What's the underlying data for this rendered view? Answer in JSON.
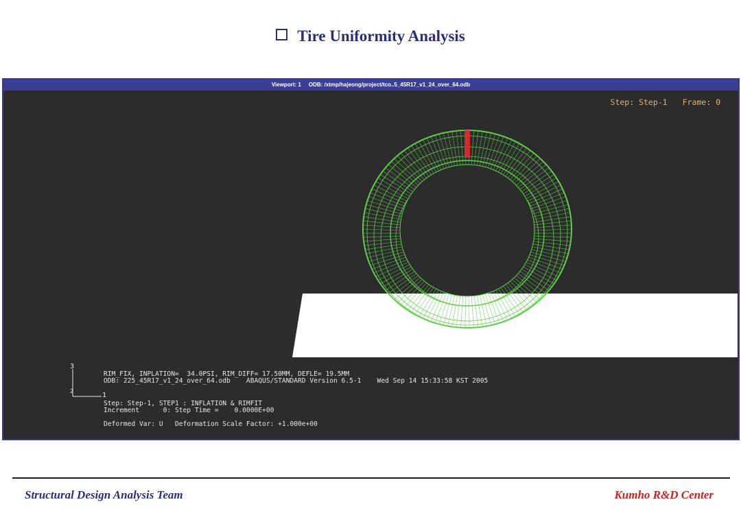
{
  "slide": {
    "title": "Tire Uniformity Analysis"
  },
  "viewport": {
    "titlebar": "Viewport: 1     ODB: /xtmp/hajeong/project/tco..5_45R17_v1_24_over_64.odb",
    "step_label": "Step: Step-1",
    "frame_label": "Frame: 0",
    "info_line1": "RIM_FIX, INPLATION=  34.0PSI, RIM_DIFF= 17.50MM, DEFLE= 19.5MM",
    "info_line2": "ODB: 225_45R17_v1_24_over_64.odb    ABAQUS/STANDARD Version 6.5-1    Wed Sep 14 15:33:58 KST 2005",
    "info_line3": "Step: Step-1, STEP1 : INFLATION & RIMFIT",
    "info_line4": "Increment      0: Step Time =    0.0000E+00",
    "info_line5": "Deformed Var: U   Deformation Scale Factor: +1.000e+00",
    "axis_3": "3",
    "axis_1": "1",
    "axis_2": "2",
    "colors": {
      "background": "#2c2c2c",
      "mesh": "#5fcf4a",
      "highlight": "#d32b2b",
      "ground": "#ffffff"
    }
  },
  "footer": {
    "left": "Structural Design Analysis Team",
    "right": "Kumho R&D Center"
  }
}
